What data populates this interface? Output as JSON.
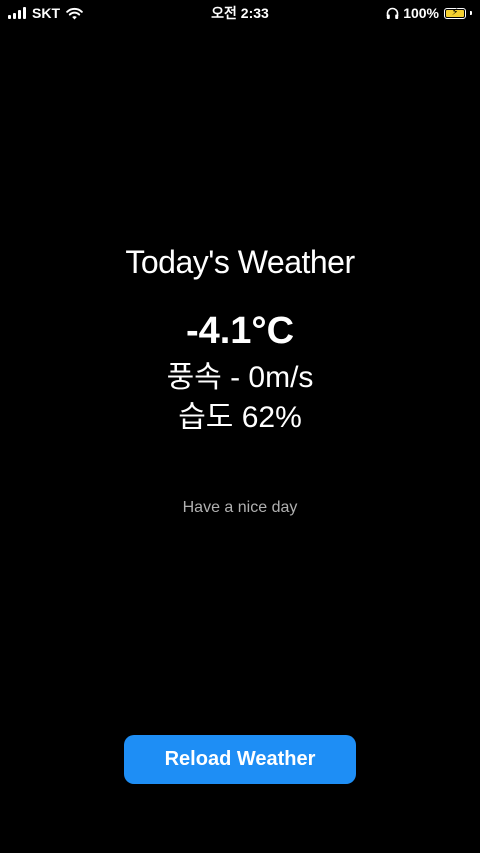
{
  "status_bar": {
    "carrier": "SKT",
    "time": "오전 2:33",
    "battery_percent": "100%",
    "battery_level": 1.0,
    "battery_color": "#f5d130",
    "charging": true,
    "icons": [
      "signal-bars-icon",
      "wifi-icon",
      "headphones-icon",
      "battery-icon",
      "charging-bolt-icon"
    ]
  },
  "weather": {
    "title": "Today's Weather",
    "temperature": "-4.1°C",
    "wind": "풍속 - 0m/s",
    "humidity": "습도 62%"
  },
  "message": "Have a nice day",
  "reload_button": {
    "label": "Reload Weather",
    "color": "#1e8ef5"
  },
  "colors": {
    "background": "#000000",
    "text": "#ffffff",
    "muted_text": "#b0b0b0"
  }
}
